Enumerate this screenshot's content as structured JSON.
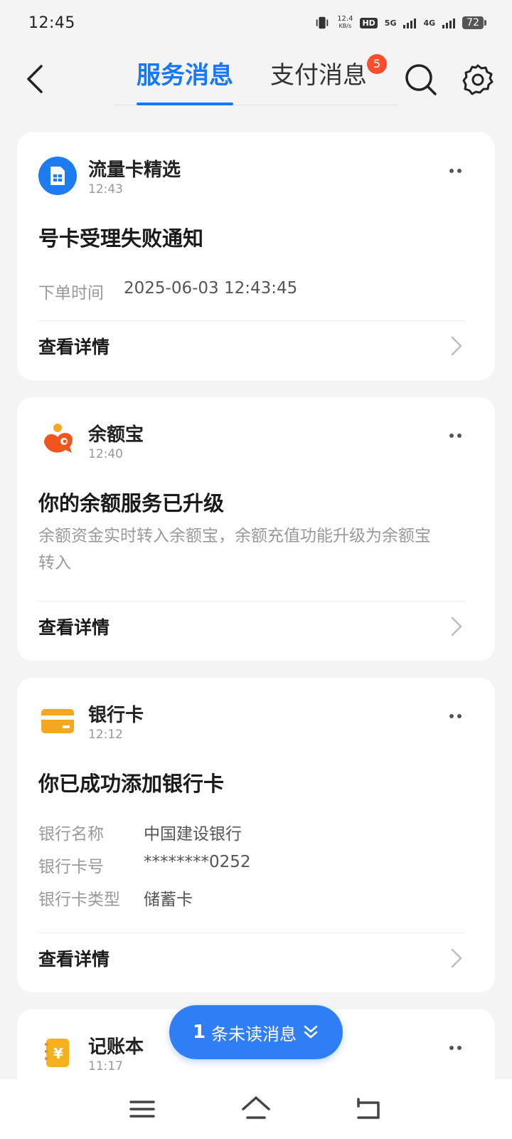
{
  "status": {
    "time": "12:45",
    "net_speed_value": "12.4",
    "net_speed_unit": "KB/s",
    "hd": "HD",
    "net1": "5G",
    "net2": "4G",
    "battery": "72"
  },
  "header": {
    "tabs": [
      {
        "label": "服务消息",
        "active": true
      },
      {
        "label": "支付消息",
        "active": false,
        "badge": "5"
      }
    ]
  },
  "cards": [
    {
      "app": "流量卡精选",
      "time": "12:43",
      "title": "号卡受理失败通知",
      "fields": [
        {
          "label": "下单时间",
          "value": "2025-06-03 12:43:45"
        }
      ],
      "detail": "查看详情"
    },
    {
      "app": "余额宝",
      "time": "12:40",
      "title": "你的余额服务已升级",
      "desc_line1": "余额资金实时转入余额宝，余额充值功能升级为余额宝",
      "desc_line2": "转入",
      "detail": "查看详情"
    },
    {
      "app": "银行卡",
      "time": "12:12",
      "title": "你已成功添加银行卡",
      "fields": [
        {
          "label": "银行名称",
          "value": "中国建设银行"
        },
        {
          "label": "银行卡号",
          "value": "********0252"
        },
        {
          "label": "银行卡类型",
          "value": "储蓄卡"
        }
      ],
      "detail": "查看详情"
    },
    {
      "app": "记账本",
      "time": "11:17"
    }
  ],
  "unread": {
    "count": "1",
    "text": "条未读消息"
  },
  "icons": {
    "icon_yen": "¥"
  },
  "colors": {
    "accent": "#1677ff",
    "badge": "#ff4d2e",
    "sim_icon_bg": "#1e7cf2",
    "yuebao": "#f0551e",
    "bank_card": "#f5a623",
    "ledger": "#f5b01e"
  }
}
